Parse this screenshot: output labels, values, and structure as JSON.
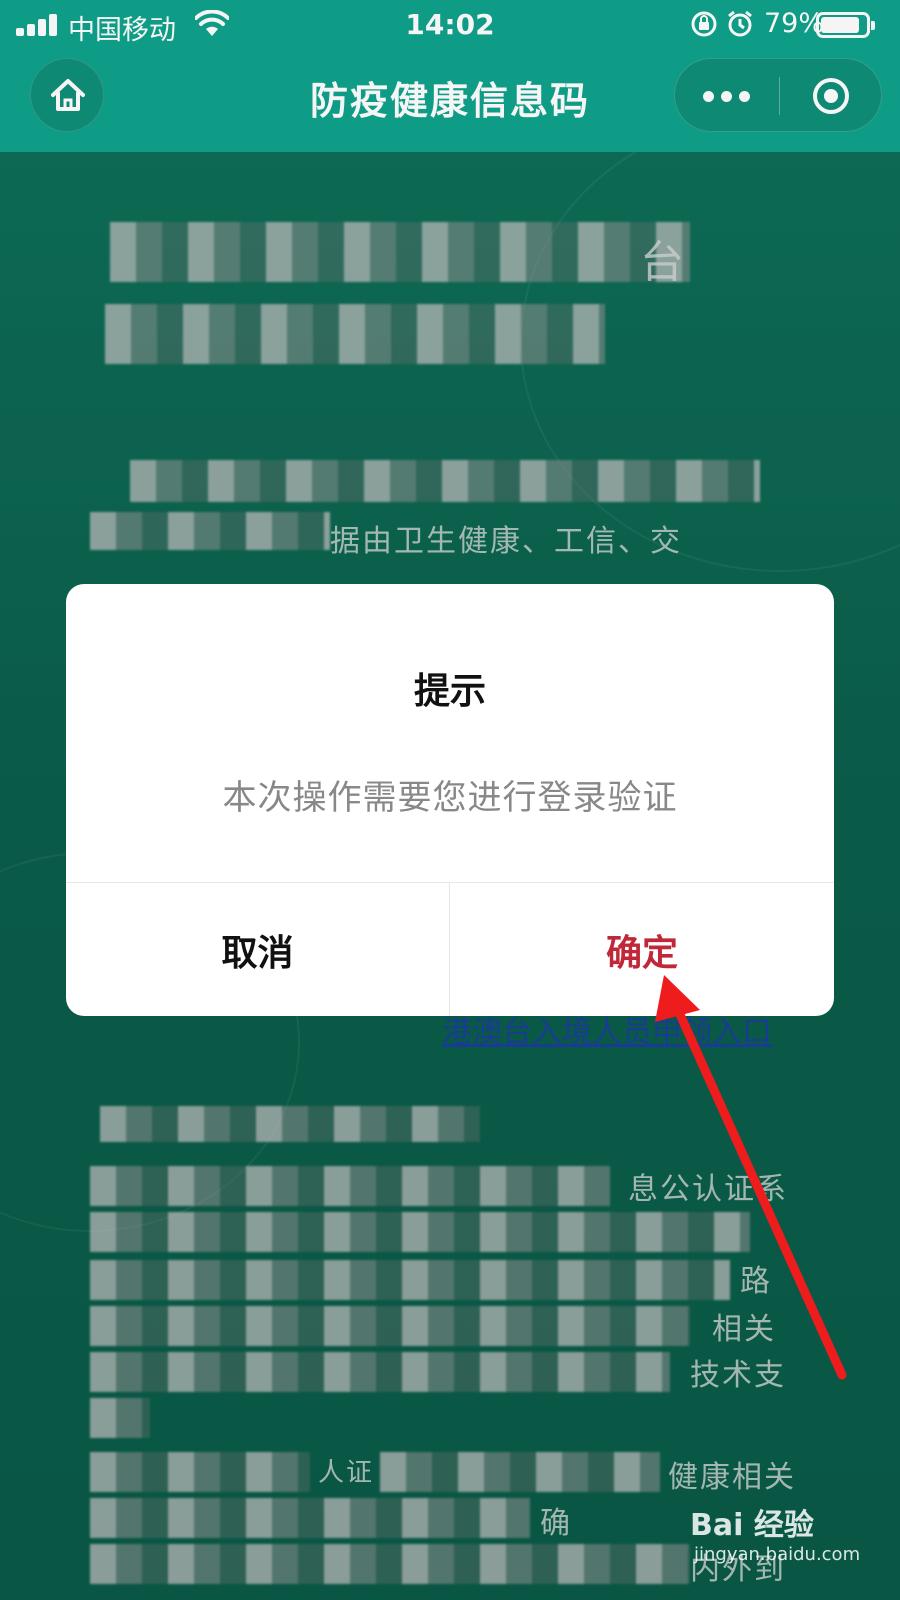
{
  "status_bar": {
    "carrier": "中国移动",
    "time": "14:02",
    "battery_percent": "79%",
    "battery_level": 0.79
  },
  "nav": {
    "title": "防疫健康信息码",
    "home_icon": "home-icon",
    "more_icon": "more-dots-icon",
    "close_icon": "mini-program-close-icon"
  },
  "background": {
    "line1": "台",
    "line2": "据由卫生健康、工信、交",
    "entry_link": "港澳台入境人员申领入口",
    "side1": "息公认证系",
    "side2": "路",
    "side3": "相关",
    "side4": "技术支",
    "side5": "人证",
    "side6": "健康相关",
    "side7": "确",
    "side8": "内外到"
  },
  "dialog": {
    "title": "提示",
    "message": "本次操作需要您进行登录验证",
    "cancel_label": "取消",
    "confirm_label": "确定"
  },
  "colors": {
    "header": "#10a38c",
    "background": "#0a5f4b",
    "confirm": "#c0283a",
    "arrow": "#ee1c1c"
  },
  "watermark": {
    "logo": "Bai 经验",
    "url": "jingyan.baidu.com"
  }
}
